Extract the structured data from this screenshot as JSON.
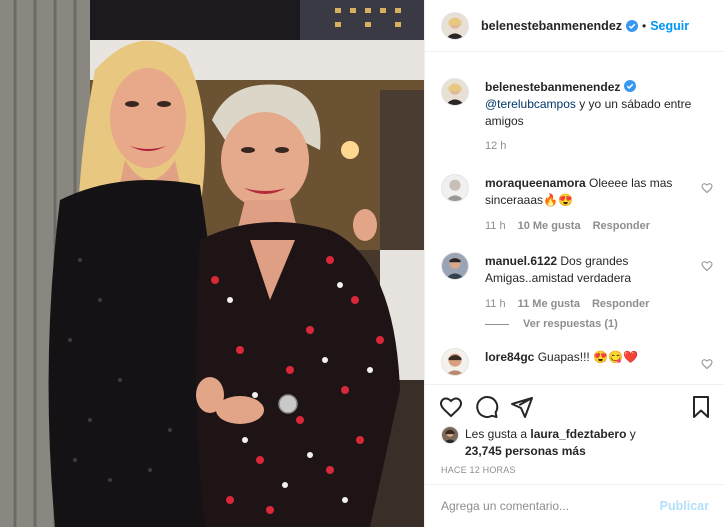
{
  "post": {
    "username": "belenestebanmenendez",
    "follow_label": "Seguir",
    "caption_mention": "@terelubcampos",
    "caption_text": " y yo un sábado entre amigos",
    "caption_time": "12 h"
  },
  "comments": [
    {
      "user": "moraqueenamora",
      "text": "Oleeee las mas sinceraaas",
      "emoji": "🔥😍",
      "time": "11 h",
      "likes": "10 Me gusta",
      "reply": "Responder"
    },
    {
      "user": "manuel.6122",
      "text": "Dos grandes Amigas..amistad verdadera",
      "time": "11 h",
      "likes": "11 Me gusta",
      "reply": "Responder",
      "view_replies": "Ver respuestas (1)"
    },
    {
      "user": "lore84gc",
      "text": "Guapas!!!",
      "emoji": "😍😋❤️"
    }
  ],
  "likes_summary": {
    "prefix": "Les gusta a ",
    "user": "laura_fdeztabero",
    "middle": " y",
    "count": "23,745 personas más"
  },
  "timestamp": "HACE 12 HORAS",
  "add_comment": {
    "placeholder": "Agrega un comentario...",
    "publish_label": "Publicar"
  },
  "colors": {
    "link_blue": "#0095f6",
    "mention_blue": "#00376b",
    "muted_gray": "#8e8e8e",
    "publish_disabled": "#b2dffc",
    "verified_blue": "#3897f0"
  }
}
